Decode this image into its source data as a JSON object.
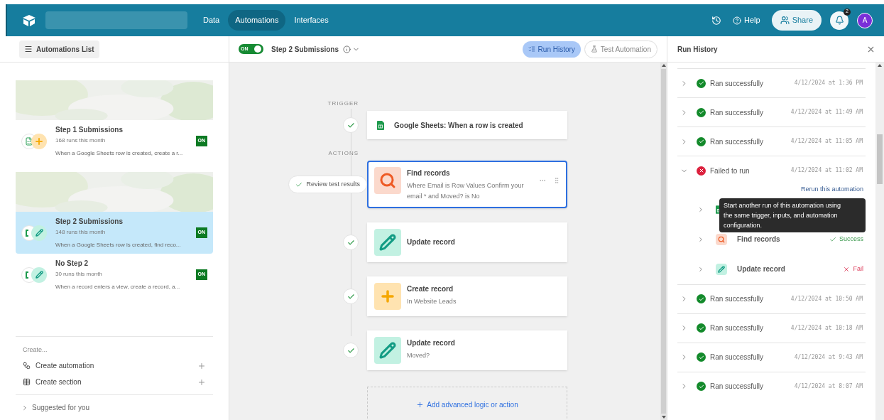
{
  "topbar": {
    "nav": [
      {
        "label": "Data",
        "selected": false
      },
      {
        "label": "Automations",
        "selected": true
      },
      {
        "label": "Interfaces",
        "selected": false
      }
    ],
    "help": "Help",
    "share": "Share",
    "notification_count": "2",
    "avatar": "A"
  },
  "sidebar": {
    "list_button": "Automations List",
    "automations": [
      {
        "name": "Step 1 Submissions",
        "runs": "168 runs this month",
        "description": "When a Google Sheets row is created, create a r...",
        "status": "ON",
        "on": true,
        "selected": false,
        "kind": "create",
        "picture": true
      },
      {
        "name": "Step 2 Submissions",
        "runs": "148 runs this month",
        "description": "When a Google Sheets row is created, find reco...",
        "status": "ON",
        "on": true,
        "selected": true,
        "kind": "update",
        "picture": true
      },
      {
        "name": "No Step 2",
        "runs": "30 runs this month",
        "description": "When a record enters a view, create a record, a...",
        "status": "ON",
        "on": true,
        "selected": false,
        "kind": "update",
        "picture": false
      }
    ],
    "create_heading": "Create...",
    "create_items": [
      {
        "kind": "automation",
        "label": "Create automation"
      },
      {
        "kind": "section",
        "label": "Create section"
      }
    ],
    "suggested": "Suggested for you"
  },
  "editor": {
    "toggle": {
      "label": "ON",
      "on": true
    },
    "title": "Step 2 Submissions",
    "buttons": [
      {
        "kind": "history",
        "label": "Run History",
        "selected": true
      },
      {
        "kind": "test",
        "label": "Test Automation",
        "selected": false
      }
    ],
    "trigger_label": "TRIGGER",
    "trigger": {
      "title": "Google Sheets: When a row is created",
      "checked": true
    },
    "actions_label": "ACTIONS",
    "actions": [
      {
        "kind": "find",
        "title": "Find records",
        "subtitle": "Where Email is Row Values Confirm your email * and Moved? is No",
        "selected": true,
        "checked": true,
        "review_label": "Review test results"
      },
      {
        "kind": "update",
        "title": "Update record",
        "selected": false,
        "checked": true
      },
      {
        "kind": "create",
        "title": "Create record",
        "subtitle": "In Website Leads",
        "selected": false,
        "checked": true
      },
      {
        "kind": "update",
        "title": "Update record",
        "subtitle": "Moved?",
        "selected": false,
        "checked": true
      }
    ],
    "add_button": "Add advanced logic or action"
  },
  "run_history": {
    "title": "Run History",
    "runs": [
      {
        "kind": "success",
        "label": "Ran successfully",
        "time": "4/12/2024 at 1:36 PM",
        "expanded": false
      },
      {
        "kind": "success",
        "label": "Ran successfully",
        "time": "4/12/2024 at 11:49 AM",
        "expanded": false
      },
      {
        "kind": "success",
        "label": "Ran successfully",
        "time": "4/12/2024 at 11:05 AM",
        "expanded": false
      },
      {
        "kind": "failed",
        "label": "Failed to run",
        "time": "4/12/2024 at 11:02 AM",
        "expanded": true,
        "rerun_link": "Rerun this automation",
        "tooltip": "Start another run of this automation using the same trigger, inputs, and automation configuration.",
        "steps": [
          {
            "kind": "sheets"
          },
          {
            "kind": "find",
            "title": "Find records",
            "result": {
              "kind": "success",
              "label": "Success"
            }
          },
          {
            "kind": "update",
            "title": "Update record",
            "result": {
              "kind": "fail",
              "label": "Fail"
            }
          }
        ]
      },
      {
        "kind": "success",
        "label": "Ran successfully",
        "time": "4/12/2024 at 10:50 AM",
        "expanded": false
      },
      {
        "kind": "success",
        "label": "Ran successfully",
        "time": "4/12/2024 at 10:18 AM",
        "expanded": false
      },
      {
        "kind": "success",
        "label": "Ran successfully",
        "time": "4/12/2024 at 9:43 AM",
        "expanded": false
      },
      {
        "kind": "success",
        "label": "Ran successfully",
        "time": "4/12/2024 at 8:07 AM",
        "expanded": false
      }
    ]
  }
}
